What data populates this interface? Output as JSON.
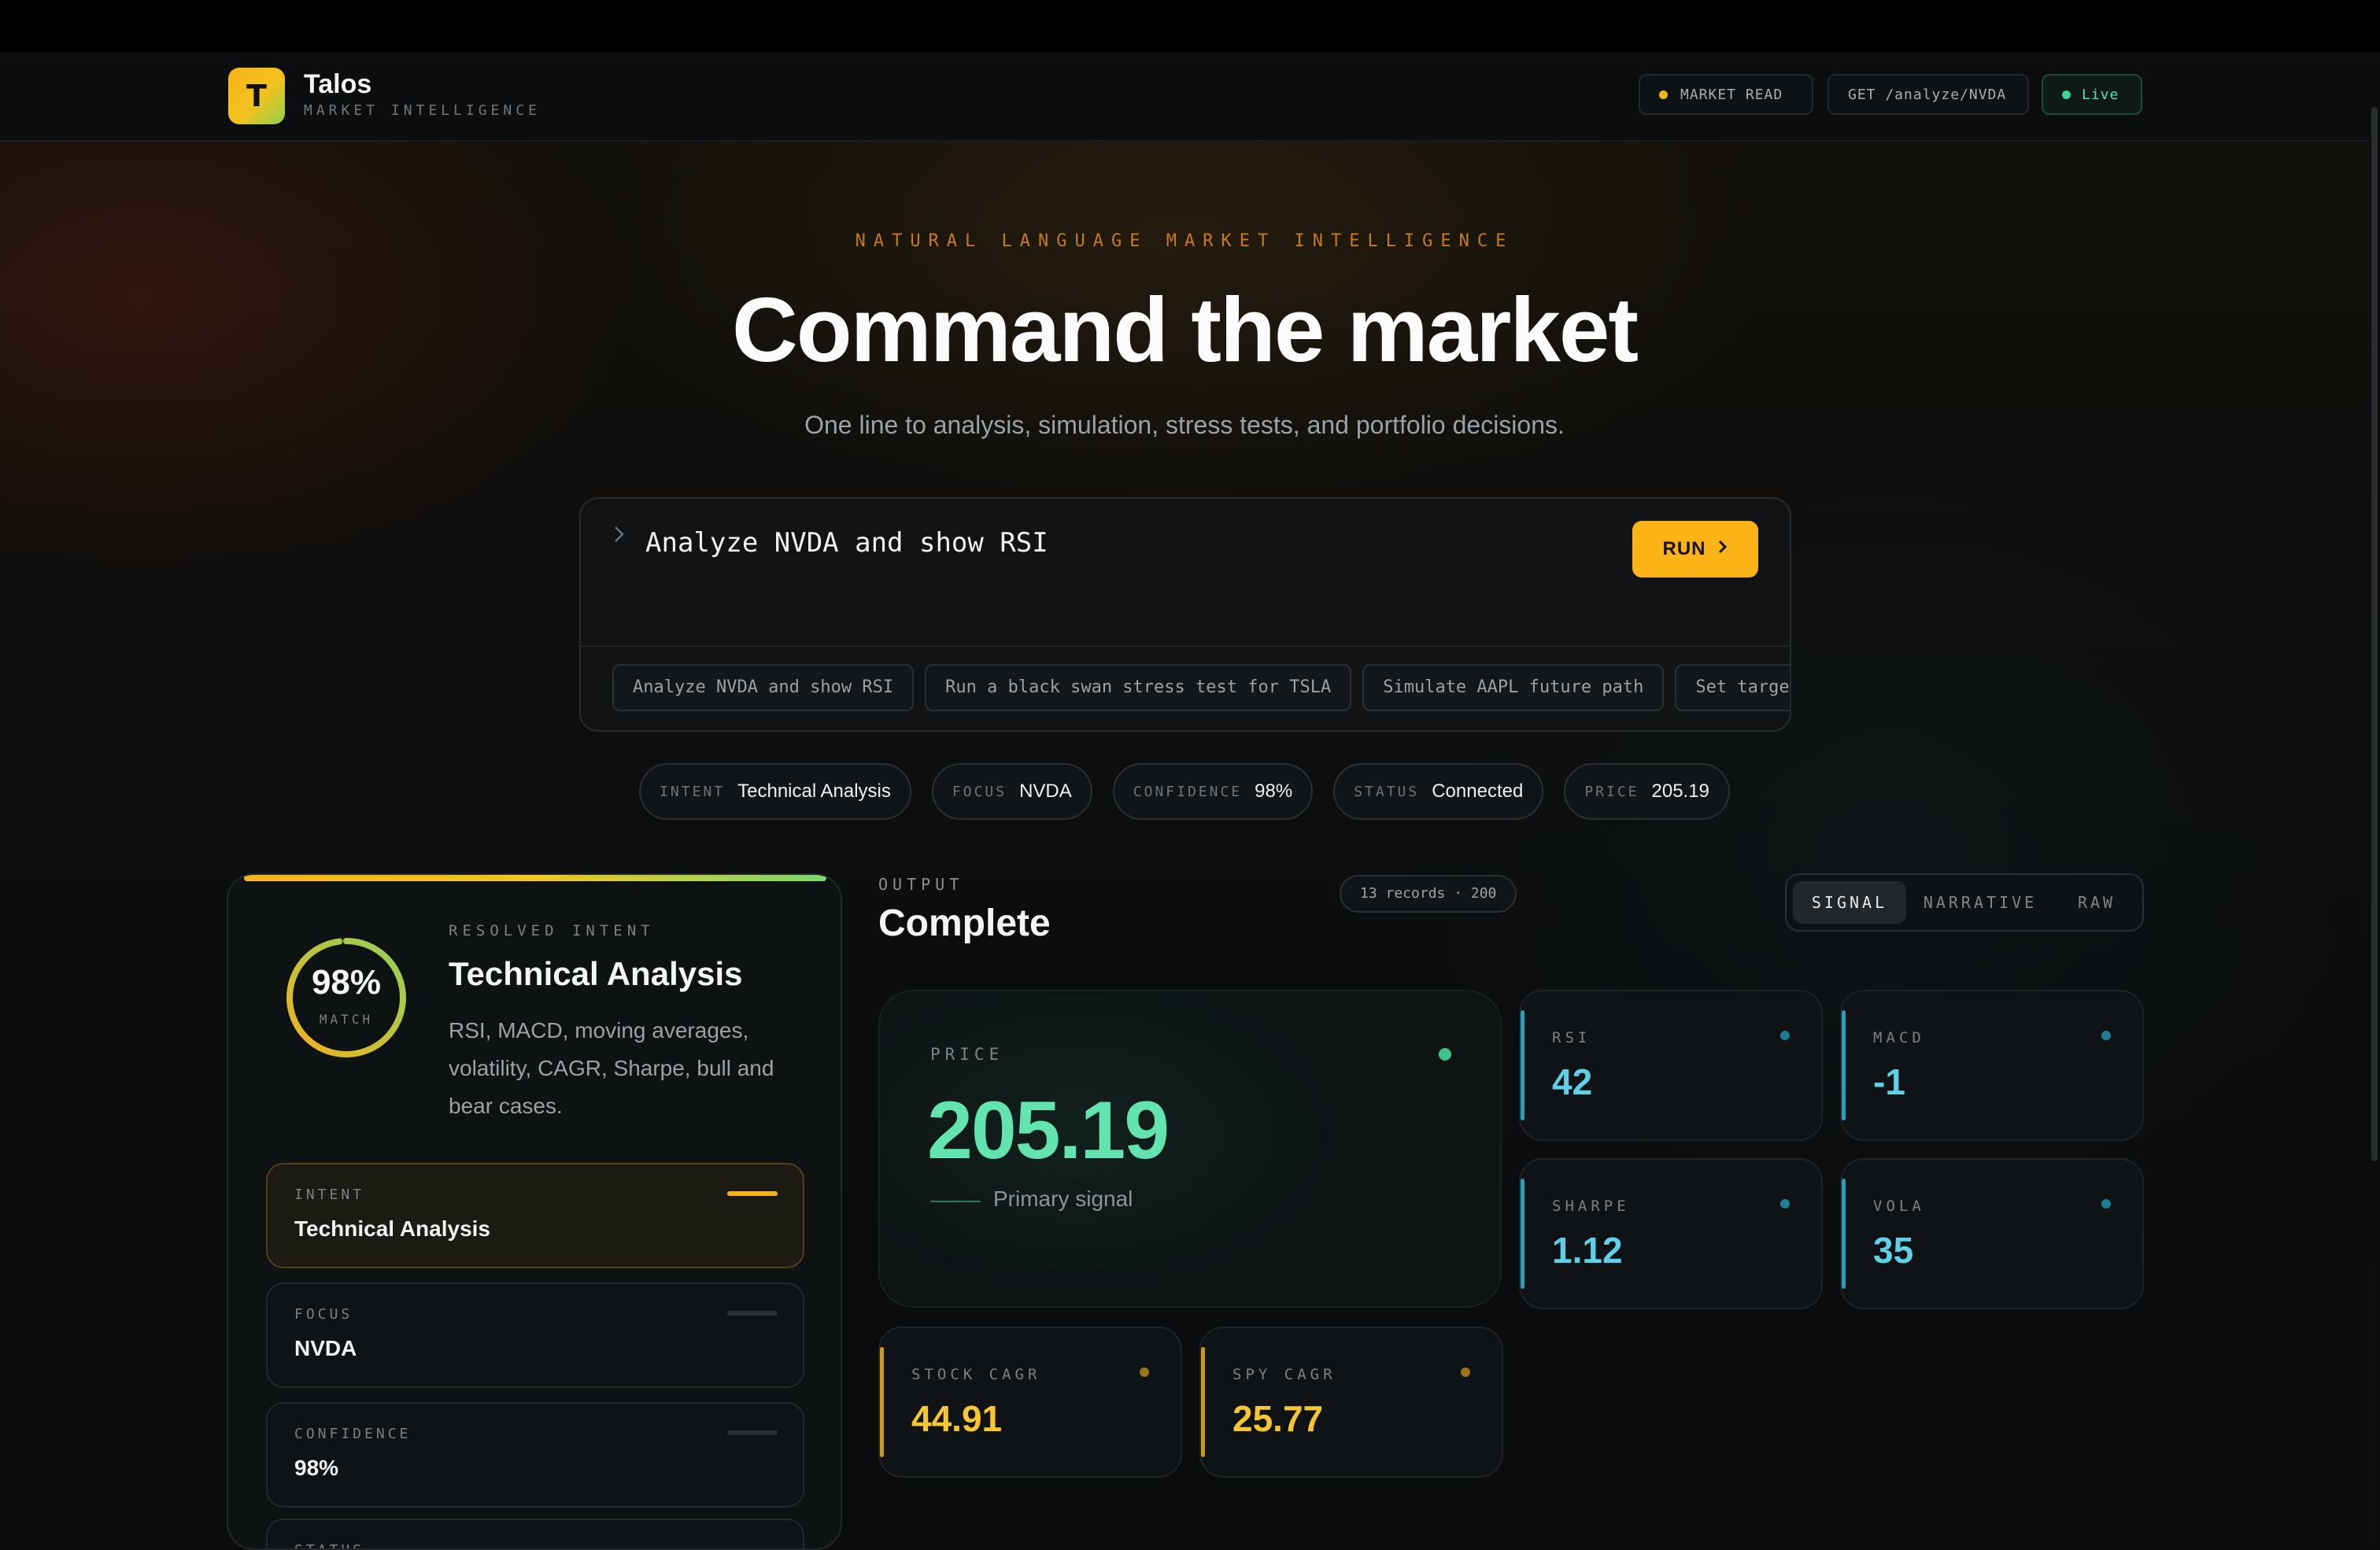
{
  "brand": {
    "name": "Talos",
    "tagline": "MARKET INTELLIGENCE",
    "logo_letter": "T"
  },
  "nav": {
    "market_read": "MARKET READ",
    "endpoint": "GET /analyze/NVDA",
    "live": "Live"
  },
  "hero": {
    "eyebrow": "NATURAL LANGUAGE MARKET INTELLIGENCE",
    "title": "Command the market",
    "subtitle": "One line to analysis, simulation, stress tests, and portfolio decisions."
  },
  "command": {
    "prompt_icon": "chevron-right-icon",
    "value": "Analyze NVDA and show RSI",
    "run_label": "RUN",
    "suggestions": [
      "Analyze NVDA and show RSI",
      "Run a black swan stress test for TSLA",
      "Simulate AAPL future path",
      "Set targe"
    ]
  },
  "stats": [
    {
      "label": "INTENT",
      "value": "Technical Analysis"
    },
    {
      "label": "FOCUS",
      "value": "NVDA"
    },
    {
      "label": "CONFIDENCE",
      "value": "98%"
    },
    {
      "label": "STATUS",
      "value": "Connected"
    },
    {
      "label": "PRICE",
      "value": "205.19"
    }
  ],
  "resolved": {
    "match_value": "98%",
    "match_fraction": 0.98,
    "match_label": "MATCH",
    "label": "RESOLVED INTENT",
    "title": "Technical Analysis",
    "description": "RSI, MACD, moving averages, volatility, CAGR, Sharpe, bull and bear cases.",
    "fields": [
      {
        "label": "INTENT",
        "value": "Technical Analysis",
        "active": true
      },
      {
        "label": "FOCUS",
        "value": "NVDA",
        "active": false
      },
      {
        "label": "CONFIDENCE",
        "value": "98%",
        "active": false
      },
      {
        "label": "STATUS",
        "value": "",
        "active": false
      }
    ]
  },
  "output": {
    "label": "OUTPUT",
    "title": "Complete",
    "records": "13 records · 200",
    "tabs": [
      "SIGNAL",
      "NARRATIVE",
      "RAW"
    ],
    "active_tab": "SIGNAL"
  },
  "price": {
    "label": "PRICE",
    "value": "205.19",
    "caption": "Primary signal"
  },
  "metrics": [
    {
      "label": "RSI",
      "value": "42"
    },
    {
      "label": "MACD",
      "value": "-1"
    },
    {
      "label": "SHARPE",
      "value": "1.12"
    },
    {
      "label": "VOLA",
      "value": "35"
    },
    {
      "label": "STOCK CAGR",
      "value": "44.91"
    },
    {
      "label": "SPY CAGR",
      "value": "25.77"
    }
  ],
  "colors": {
    "accent_yellow": "#fbb316",
    "live_green": "#3dd39a",
    "price_green": "#62e3b0",
    "metric_cyan": "#5ed0e8",
    "metric_yellow": "#f5c631"
  }
}
